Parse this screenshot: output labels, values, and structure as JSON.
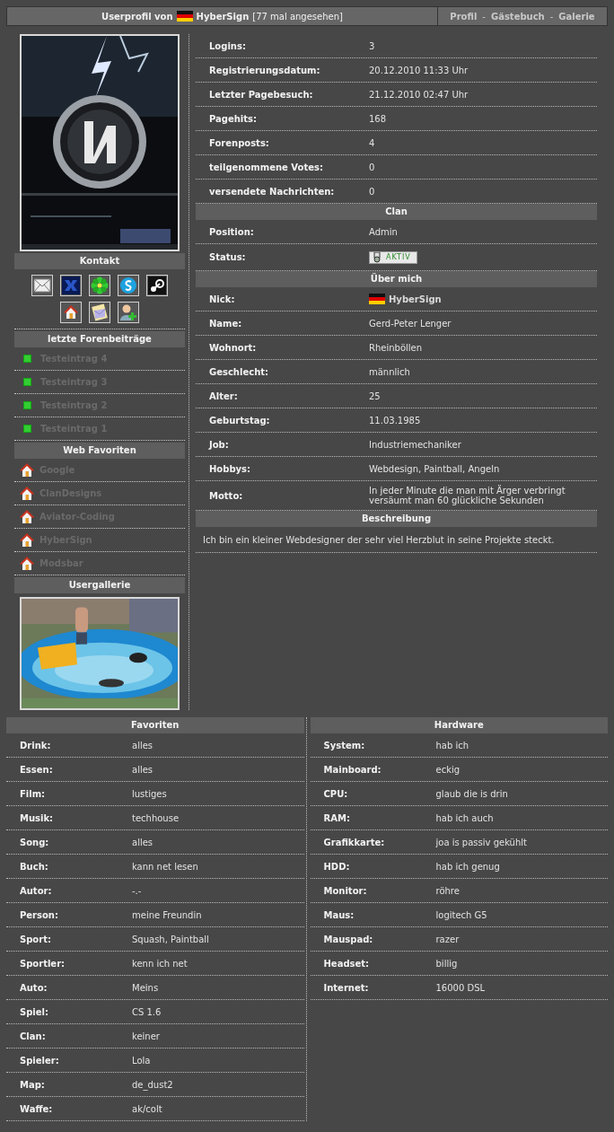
{
  "header": {
    "prefix": "Userprofil von",
    "username": "HyberSign",
    "views": "[77 mal angesehen]"
  },
  "nav": [
    {
      "kind": "link",
      "label": "Profil"
    },
    {
      "kind": "separator",
      "label": "-"
    },
    {
      "kind": "link",
      "label": "Gästebuch"
    },
    {
      "kind": "separator",
      "label": "-"
    },
    {
      "kind": "link",
      "label": "Galerie"
    }
  ],
  "sidebar": {
    "contact_title": "Kontakt",
    "forum_title": "letzte Forenbeiträge",
    "forum_posts": [
      "Testeintrag 4",
      "Testeintrag 3",
      "Testeintrag 2",
      "Testeintrag 1"
    ],
    "favorites_title": "Web Favoriten",
    "web_favorites": [
      "Google",
      "ClanDesigns",
      "Aviator-Coding",
      "HyberSign",
      "Modsbar"
    ],
    "gallery_title": "Usergallerie"
  },
  "stats": [
    {
      "label": "Logins:",
      "value": "3"
    },
    {
      "label": "Registrierungsdatum:",
      "value": "20.12.2010 11:33 Uhr"
    },
    {
      "label": "Letzter Pagebesuch:",
      "value": "21.12.2010 02:47 Uhr"
    },
    {
      "label": "Pagehits:",
      "value": "168"
    },
    {
      "label": "Forenposts:",
      "value": "4"
    },
    {
      "label": "teilgenommene Votes:",
      "value": "0"
    },
    {
      "label": "versendete Nachrichten:",
      "value": "0"
    }
  ],
  "clan": {
    "title": "Clan",
    "rows": [
      {
        "kind": "text",
        "label": "Position:",
        "value": "Admin"
      },
      {
        "kind": "status",
        "label": "Status:",
        "value": "AKTIV"
      }
    ]
  },
  "about": {
    "title": "Über mich",
    "rows": [
      {
        "kind": "nick",
        "label": "Nick:",
        "value": "HyberSign"
      },
      {
        "kind": "text",
        "label": "Name:",
        "value": "Gerd-Peter Lenger"
      },
      {
        "kind": "text",
        "label": "Wohnort:",
        "value": "Rheinböllen"
      },
      {
        "kind": "text",
        "label": "Geschlecht:",
        "value": "männlich"
      },
      {
        "kind": "text",
        "label": "Alter:",
        "value": "25"
      },
      {
        "kind": "text",
        "label": "Geburtstag:",
        "value": "11.03.1985"
      },
      {
        "kind": "text",
        "label": "Job:",
        "value": "Industriemechaniker"
      },
      {
        "kind": "text",
        "label": "Hobbys:",
        "value": "Webdesign, Paintball, Angeln"
      },
      {
        "kind": "text",
        "label": "Motto:",
        "value": "In jeder Minute die man mit Ärger verbringt versäumt man 60 glückliche Sekunden"
      }
    ]
  },
  "description": {
    "title": "Beschreibung",
    "text": "Ich bin ein kleiner Webdesigner der sehr viel Herzblut in seine Projekte steckt."
  },
  "favorites": {
    "title": "Favoriten",
    "rows": [
      {
        "label": "Drink:",
        "value": "alles"
      },
      {
        "label": "Essen:",
        "value": "alles"
      },
      {
        "label": "Film:",
        "value": "lustiges"
      },
      {
        "label": "Musik:",
        "value": "techhouse"
      },
      {
        "label": "Song:",
        "value": "alles"
      },
      {
        "label": "Buch:",
        "value": "kann net lesen"
      },
      {
        "label": "Autor:",
        "value": "-.-"
      },
      {
        "label": "Person:",
        "value": "meine Freundin"
      },
      {
        "label": "Sport:",
        "value": "Squash, Paintball"
      },
      {
        "label": "Sportler:",
        "value": "kenn ich net"
      },
      {
        "label": "Auto:",
        "value": "Meins"
      },
      {
        "label": "Spiel:",
        "value": "CS 1.6"
      },
      {
        "label": "Clan:",
        "value": "keiner"
      },
      {
        "label": "Spieler:",
        "value": "Lola"
      },
      {
        "label": "Map:",
        "value": "de_dust2"
      },
      {
        "label": "Waffe:",
        "value": "ak/colt"
      }
    ]
  },
  "hardware": {
    "title": "Hardware",
    "rows": [
      {
        "label": "System:",
        "value": "hab ich"
      },
      {
        "label": "Mainboard:",
        "value": "eckig"
      },
      {
        "label": "CPU:",
        "value": "glaub die is drin"
      },
      {
        "label": "RAM:",
        "value": "hab ich auch"
      },
      {
        "label": "Grafikkarte:",
        "value": "joa is passiv gekühlt"
      },
      {
        "label": "HDD:",
        "value": "hab ich genug"
      },
      {
        "label": "Monitor:",
        "value": "röhre"
      },
      {
        "label": "Maus:",
        "value": "logitech G5"
      },
      {
        "label": "Mauspad:",
        "value": "razer"
      },
      {
        "label": "Headset:",
        "value": "billig"
      },
      {
        "label": "Internet:",
        "value": "16000 DSL"
      }
    ]
  }
}
